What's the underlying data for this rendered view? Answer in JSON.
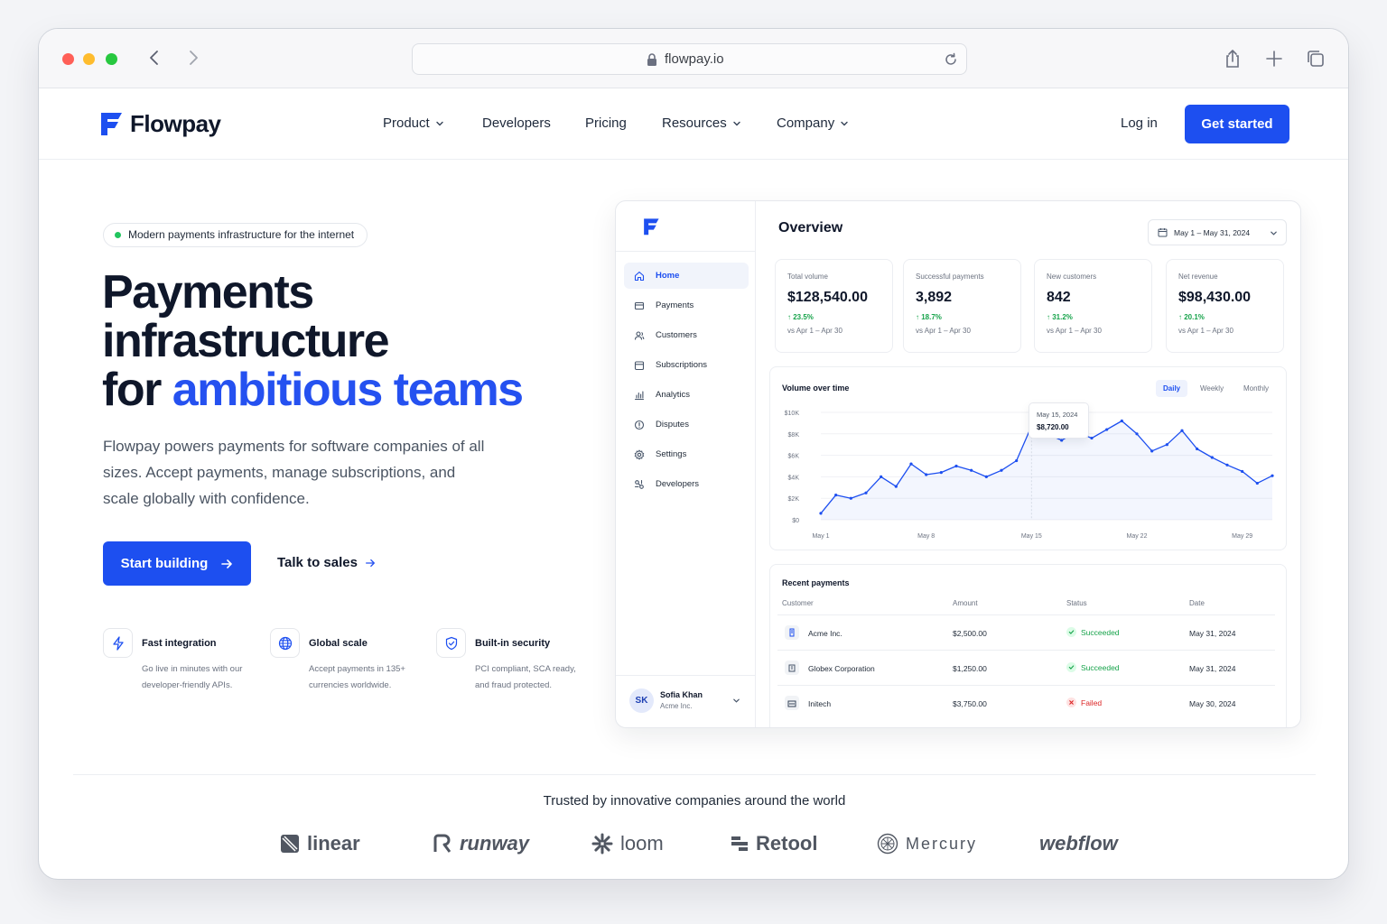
{
  "browser": {
    "url": "flowpay.io"
  },
  "header": {
    "brand": "Flowpay",
    "nav": [
      {
        "label": "Product",
        "dropdown": true
      },
      {
        "label": "Developers",
        "dropdown": false
      },
      {
        "label": "Pricing",
        "dropdown": false
      },
      {
        "label": "Resources",
        "dropdown": true
      },
      {
        "label": "Company",
        "dropdown": true
      }
    ],
    "login": "Log in",
    "cta": "Get started",
    "accent_color": "#1d4ff0"
  },
  "hero": {
    "badge": "Modern payments infrastructure for the internet",
    "title_line1": "Payments",
    "title_line2": "infrastructure",
    "title_line3_prefix": "for ",
    "title_line3_accent": "ambitious teams",
    "subtitle": "Flowpay powers payments for software companies of all sizes. Accept payments, manage subscriptions, and scale globally with confidence.",
    "primary_button": "Start building",
    "secondary_button": "Talk to sales",
    "features": [
      {
        "icon": "bolt-icon",
        "title": "Fast integration",
        "desc": "Go live in minutes with our developer-friendly APIs."
      },
      {
        "icon": "globe-icon",
        "title": "Global scale",
        "desc": "Accept payments in 135+ currencies worldwide."
      },
      {
        "icon": "shield-icon",
        "title": "Built-in security",
        "desc": "PCI compliant, SCA ready, and fraud protected."
      }
    ]
  },
  "dashboard": {
    "sidebar": [
      {
        "label": "Home",
        "icon": "home-icon",
        "active": true
      },
      {
        "label": "Payments",
        "icon": "payments-icon",
        "active": false
      },
      {
        "label": "Customers",
        "icon": "customers-icon",
        "active": false
      },
      {
        "label": "Subscriptions",
        "icon": "subscriptions-icon",
        "active": false
      },
      {
        "label": "Analytics",
        "icon": "analytics-icon",
        "active": false
      },
      {
        "label": "Disputes",
        "icon": "disputes-icon",
        "active": false
      },
      {
        "label": "Settings",
        "icon": "settings-icon",
        "active": false
      },
      {
        "label": "Developers",
        "icon": "developers-icon",
        "active": false
      }
    ],
    "user": {
      "initials": "SK",
      "name": "Sofia Khan",
      "org": "Acme Inc."
    },
    "title": "Overview",
    "date_range": "May 1 – May 31, 2024",
    "metrics": [
      {
        "label": "Total volume",
        "value": "$128,540.00",
        "delta": "↑ 23.5%",
        "compare": "vs Apr 1 – Apr 30"
      },
      {
        "label": "Successful payments",
        "value": "3,892",
        "delta": "↑ 18.7%",
        "compare": "vs Apr 1 – Apr 30"
      },
      {
        "label": "New customers",
        "value": "842",
        "delta": "↑ 31.2%",
        "compare": "vs Apr 1 – Apr 30"
      },
      {
        "label": "Net revenue",
        "value": "$98,430.00",
        "delta": "↑ 20.1%",
        "compare": "vs Apr 1 – Apr 30"
      }
    ],
    "chart": {
      "title": "Volume over time",
      "periods": [
        "Daily",
        "Weekly",
        "Monthly"
      ],
      "active_period": "Daily",
      "tooltip_date": "May 15, 2024",
      "tooltip_value": "$8,720.00"
    },
    "recent": {
      "title": "Recent payments",
      "columns": [
        "Customer",
        "Amount",
        "Status",
        "Date"
      ],
      "rows": [
        {
          "customer": "Acme Inc.",
          "amount": "$2,500.00",
          "status": "Succeeded",
          "ok": true,
          "date": "May 31, 2024"
        },
        {
          "customer": "Globex Corporation",
          "amount": "$1,250.00",
          "status": "Succeeded",
          "ok": true,
          "date": "May 31, 2024"
        },
        {
          "customer": "Initech",
          "amount": "$3,750.00",
          "status": "Failed",
          "ok": false,
          "date": "May 30, 2024"
        }
      ]
    }
  },
  "chart_data": {
    "type": "line",
    "title": "Volume over time",
    "xlabel": "",
    "ylabel": "",
    "x_ticks": [
      "May 1",
      "May 8",
      "May 15",
      "May 22",
      "May 29"
    ],
    "y_ticks": [
      "$0",
      "$2K",
      "$4K",
      "$6K",
      "$8K",
      "$10K"
    ],
    "ylim": [
      0,
      10000
    ],
    "grid": true,
    "x": [
      1,
      2,
      3,
      4,
      5,
      6,
      7,
      8,
      9,
      10,
      11,
      12,
      13,
      14,
      15,
      16,
      17,
      18,
      19,
      20,
      21,
      22,
      23,
      24,
      25,
      26,
      27,
      28,
      29,
      30,
      31
    ],
    "series": [
      {
        "name": "",
        "color": "#1d4ff0",
        "values": [
          600,
          2300,
          2000,
          2500,
          4000,
          3100,
          5200,
          4200,
          4400,
          5000,
          4600,
          4000,
          4600,
          5500,
          8720,
          8000,
          7400,
          8200,
          7600,
          8400,
          9200,
          8000,
          6400,
          7000,
          8300,
          6600,
          5800,
          5100,
          4500,
          3400,
          4100
        ]
      }
    ]
  },
  "trusted": {
    "heading": "Trusted by innovative companies around the world",
    "logos": [
      "linear",
      "runway",
      "loom",
      "Retool",
      "Mercury",
      "webflow"
    ]
  }
}
